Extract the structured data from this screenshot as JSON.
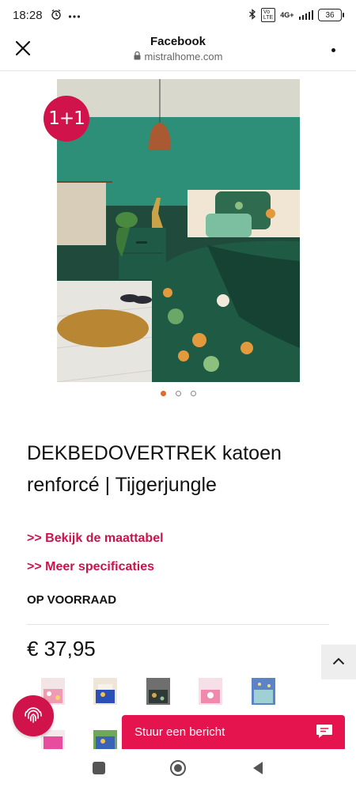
{
  "status_bar": {
    "time": "18:28",
    "network": "4G+",
    "battery": "36",
    "icons": [
      "alarm-icon",
      "more-notifications-icon",
      "bluetooth-icon",
      "volte-icon",
      "signal-icon",
      "battery-icon"
    ]
  },
  "browser": {
    "title": "Facebook",
    "url": "mistralhome.com",
    "icons": [
      "close-icon",
      "lock-icon",
      "more-options-icon"
    ]
  },
  "product": {
    "badge": "1+1",
    "carousel": {
      "count": 3,
      "active_index": 0,
      "active_color": "#e8682d"
    },
    "title": "DEKBEDOVERTREK katoen renforcé | Tijgerjungle",
    "link_size": ">> Bekijk de maattabel",
    "link_specs": ">> Meer specificaties",
    "stock": "OP VOORRAAD",
    "price": "€ 37,95",
    "variants": [
      "variant-pink-floral",
      "variant-blue-animals",
      "variant-dark-floral",
      "variant-pink-unicorn",
      "variant-blue-stars",
      "variant-pink-bedding",
      "variant-green-jungle"
    ]
  },
  "chat": {
    "label": "Stuur een bericht"
  },
  "colors": {
    "brand": "#d0134a",
    "chat": "#e5134e",
    "link": "#c9134b"
  },
  "nav": {
    "icons": [
      "recent-apps-icon",
      "home-icon",
      "back-icon"
    ]
  }
}
